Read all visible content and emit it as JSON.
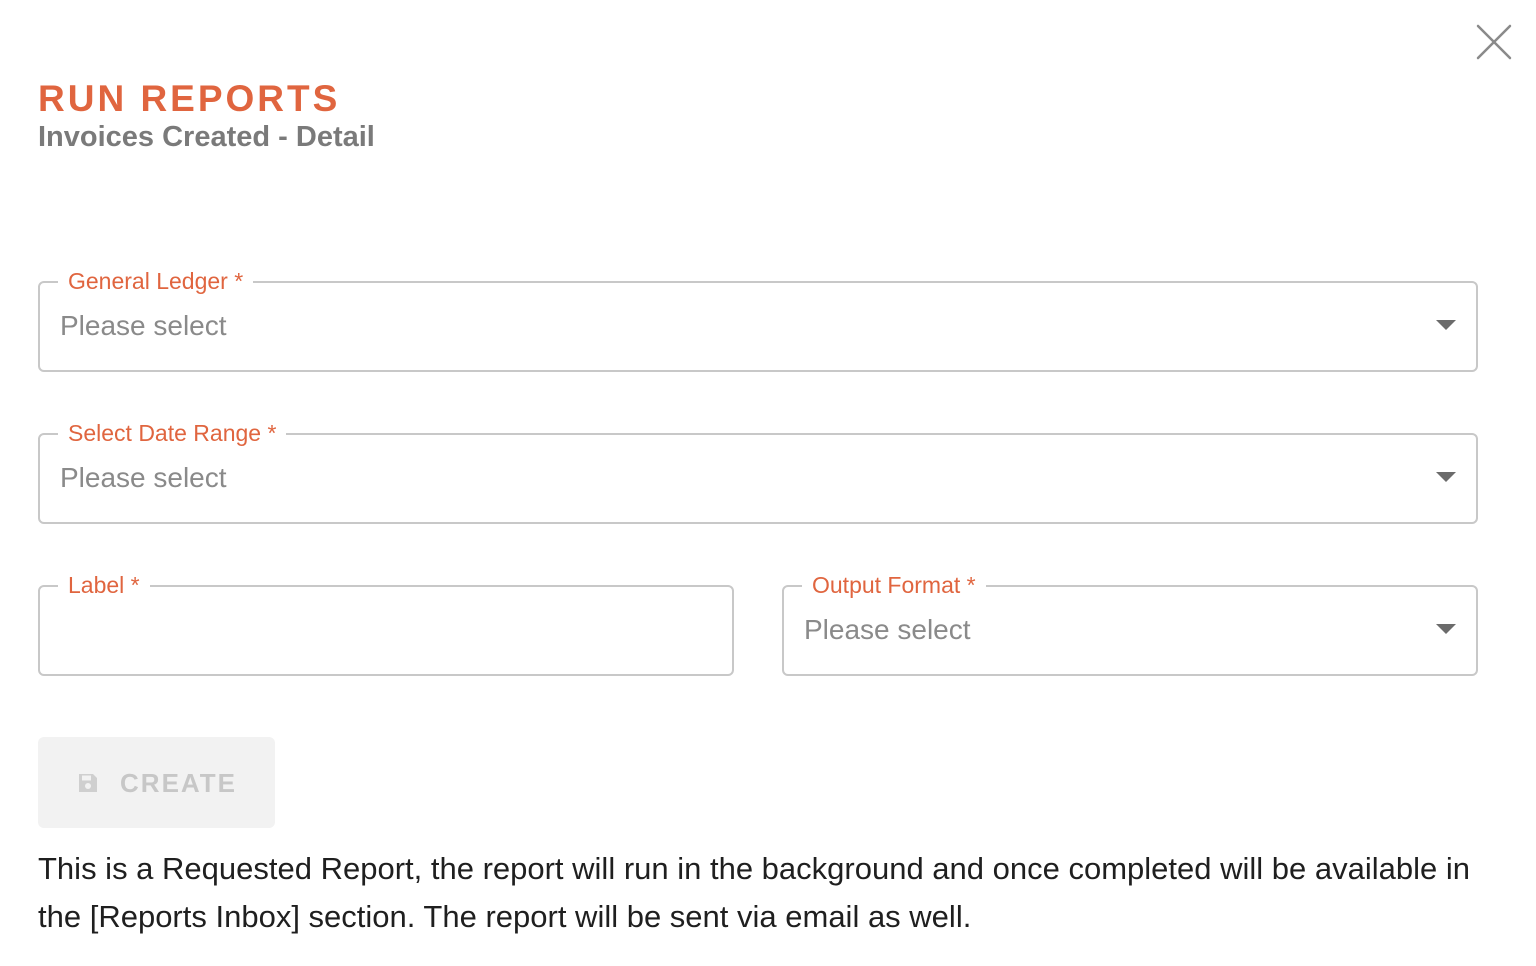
{
  "dialog": {
    "title": "RUN REPORTS",
    "subtitle": "Invoices Created - Detail",
    "close_icon": "close-icon"
  },
  "form": {
    "general_ledger": {
      "label": "General Ledger *",
      "value": "Please select"
    },
    "date_range": {
      "label": "Select Date Range *",
      "value": "Please select"
    },
    "label_field": {
      "label": "Label *",
      "value": ""
    },
    "output_format": {
      "label": "Output Format *",
      "value": "Please select"
    }
  },
  "actions": {
    "create_label": "CREATE",
    "create_icon": "save-icon",
    "create_disabled": true
  },
  "note": "This is a Requested Report, the report will run in the background and once completed will be available in the [Reports Inbox] section. The report will be sent via email as well.",
  "colors": {
    "accent": "#e0653f",
    "subtitle": "#7a7a7a",
    "border": "#c8c8c8",
    "placeholder": "#8a8a8a",
    "disabled_bg": "#f2f2f2",
    "disabled_text": "#c7c7c7"
  }
}
